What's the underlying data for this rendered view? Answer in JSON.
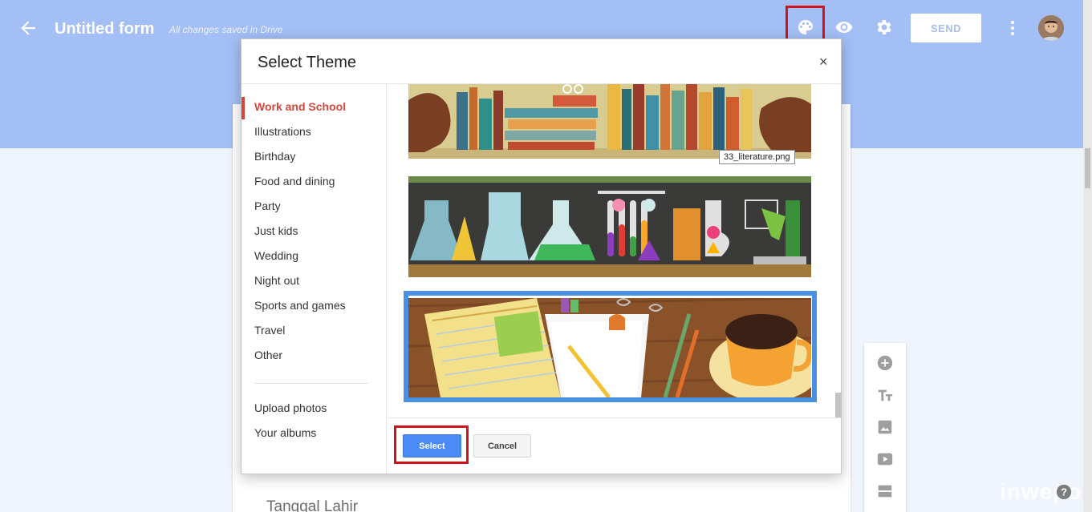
{
  "header": {
    "back_icon": "arrow-left-icon",
    "title": "Untitled form",
    "status": "All changes saved in Drive",
    "icons": [
      "palette-icon",
      "eye-icon",
      "gear-icon"
    ],
    "send_label": "SEND",
    "more_icon": "vertical-dots-icon"
  },
  "form": {
    "question_title": "Tanggal Lahir"
  },
  "dialog": {
    "title": "Select Theme",
    "close_label": "×",
    "categories": [
      {
        "label": "Work and School"
      },
      {
        "label": "Illustrations"
      },
      {
        "label": "Birthday"
      },
      {
        "label": "Food and dining"
      },
      {
        "label": "Party"
      },
      {
        "label": "Just kids"
      },
      {
        "label": "Wedding"
      },
      {
        "label": "Night out"
      },
      {
        "label": "Sports and games"
      },
      {
        "label": "Travel"
      },
      {
        "label": "Other"
      }
    ],
    "active_category": "Work and School",
    "extra": [
      {
        "label": "Upload photos"
      },
      {
        "label": "Your albums"
      }
    ],
    "tooltip": "33_literature.png",
    "select_label": "Select",
    "cancel_label": "Cancel"
  },
  "tools": [
    "add-circle-icon",
    "text-title-icon",
    "image-icon",
    "video-icon",
    "section-icon"
  ],
  "watermark": "inwepo",
  "colors": {
    "header_bg": "#a3bff5",
    "accent_red": "#d4453a",
    "select_blue": "#4a8af4",
    "highlight_red": "#d0121b",
    "selected_border": "#4a90e2"
  }
}
